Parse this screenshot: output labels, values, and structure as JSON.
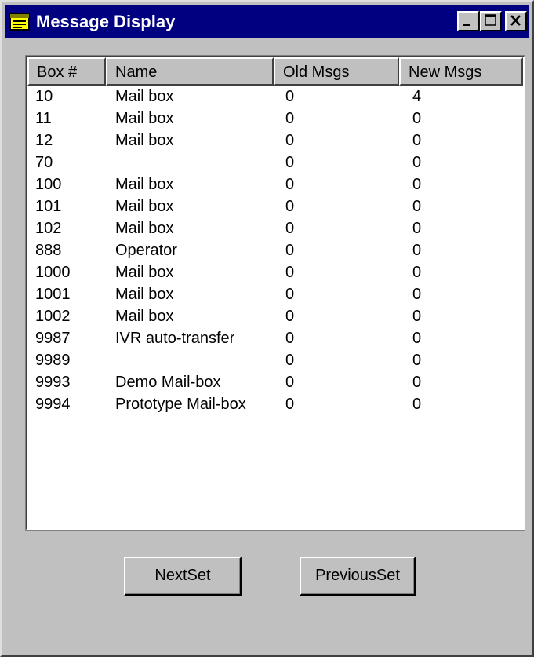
{
  "window": {
    "title": "Message Display",
    "icon": "message-display-icon",
    "controls": [
      "minimize-icon",
      "maximize-icon",
      "close-icon"
    ]
  },
  "listview": {
    "columns": [
      "Box #",
      "Name",
      "Old Msgs",
      "New Msgs"
    ],
    "rows": [
      [
        "10",
        "Mail box",
        "0",
        "4"
      ],
      [
        "11",
        "Mail box",
        "0",
        "0"
      ],
      [
        "12",
        "Mail box",
        "0",
        "0"
      ],
      [
        "70",
        "",
        "0",
        "0"
      ],
      [
        "100",
        "Mail box",
        "0",
        "0"
      ],
      [
        "101",
        "Mail box",
        "0",
        "0"
      ],
      [
        "102",
        "Mail box",
        "0",
        "0"
      ],
      [
        "888",
        "Operator",
        "0",
        "0"
      ],
      [
        "1000",
        "Mail box",
        "0",
        "0"
      ],
      [
        "1001",
        "Mail box",
        "0",
        "0"
      ],
      [
        "1002",
        "Mail box",
        "0",
        "0"
      ],
      [
        "9987",
        "IVR auto-transfer",
        "0",
        "0"
      ],
      [
        "9989",
        "",
        "0",
        "0"
      ],
      [
        "9993",
        "Demo Mail-box",
        "0",
        "0"
      ],
      [
        "9994",
        "Prototype Mail-box",
        "0",
        "0"
      ]
    ]
  },
  "buttons": {
    "next_label": "NextSet",
    "previous_label": "PreviousSet"
  },
  "colors": {
    "titlebar": "#000080",
    "face": "#c0c0c0",
    "list_background": "#ffffff"
  }
}
